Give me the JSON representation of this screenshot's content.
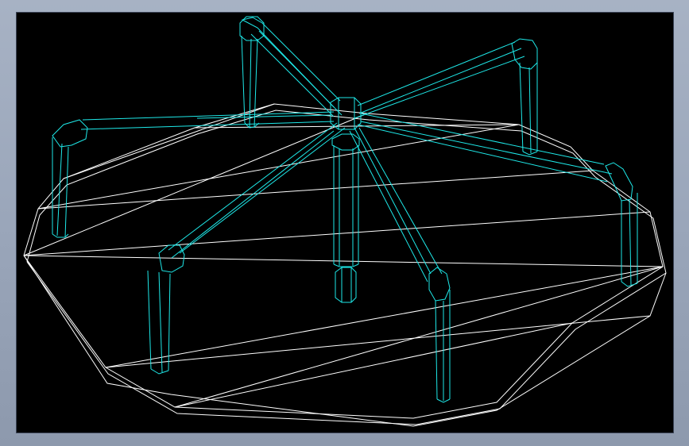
{
  "colors": {
    "window_background": "#9aa6ba",
    "viewport_background": "#000000",
    "platform_wireframe": "#ffffff",
    "frame_wireframe": "#1ee8e8"
  }
}
